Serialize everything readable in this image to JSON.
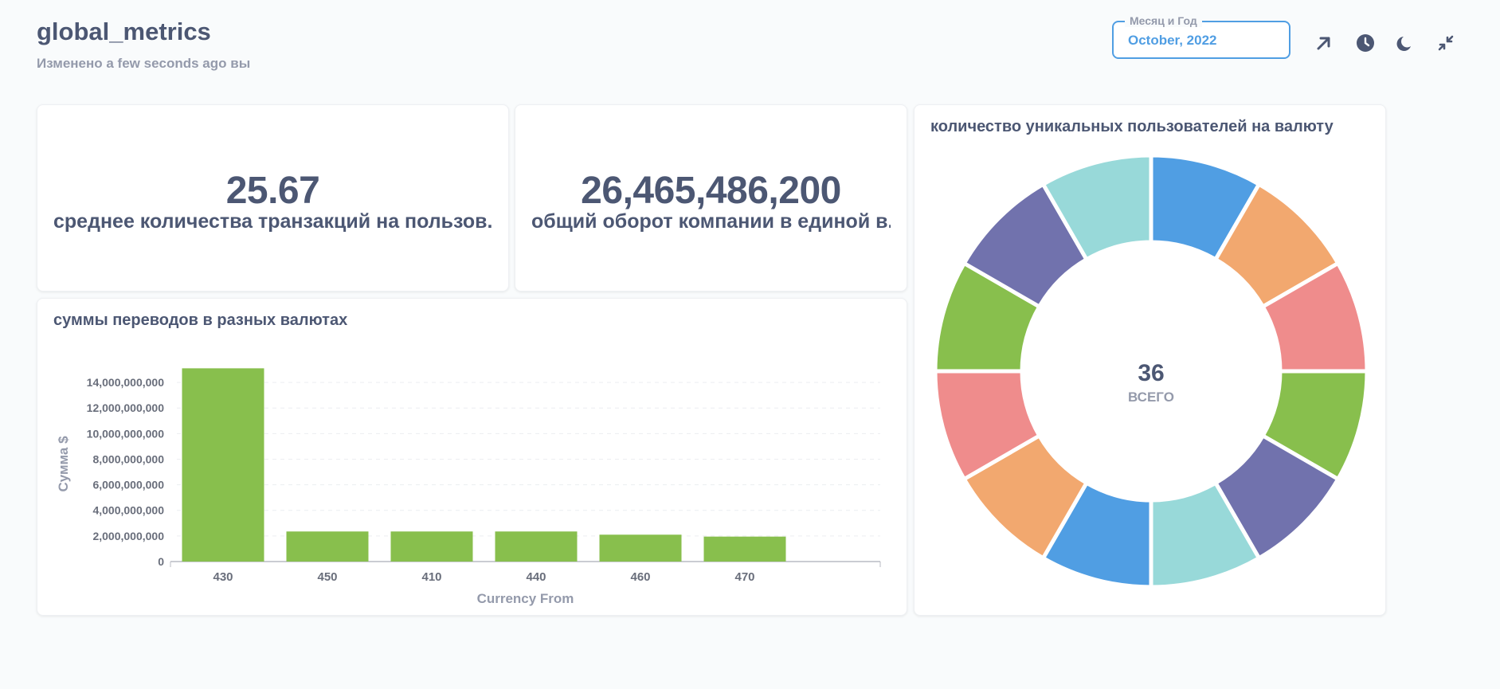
{
  "dashboard": {
    "title": "global_metrics",
    "subtitle": "Изменено a few seconds ago вы"
  },
  "filter": {
    "label": "Месяц и Год",
    "value": "October, 2022"
  },
  "header_icons": [
    "expand-arrow-icon",
    "clock-icon",
    "moon-icon",
    "collapse-icon"
  ],
  "cards": {
    "avg_tx": {
      "value": "25.67",
      "label": "среднее количества транзакций на пользов..."
    },
    "turnover": {
      "value": "26,465,486,200",
      "label": "общий оборот компании в единой в..."
    },
    "bar_chart": {
      "title": "суммы переводов в разных валютах"
    },
    "donut": {
      "title": "количество уникальных пользователей на валюту"
    }
  },
  "colors": {
    "accent": "#509ee3",
    "bar": "#88bf4d",
    "text": "#4c5773",
    "muted": "#949aab"
  },
  "chart_data": [
    {
      "type": "bar",
      "title": "суммы переводов в разных валютах",
      "xlabel": "Currency From",
      "ylabel": "Сумма $",
      "categories": [
        "430",
        "450",
        "410",
        "440",
        "460",
        "470"
      ],
      "values": [
        15100000000,
        2350000000,
        2350000000,
        2350000000,
        2100000000,
        1950000000
      ],
      "ylim": [
        0,
        15000000000
      ],
      "yticks": [
        "0",
        "2,000,000,000",
        "4,000,000,000",
        "6,000,000,000",
        "8,000,000,000",
        "10,000,000,000",
        "12,000,000,000",
        "14,000,000,000"
      ],
      "grid": true,
      "color": "#88bf4d"
    },
    {
      "type": "pie",
      "title": "количество уникальных пользователей на валюту",
      "donut": true,
      "total": "36",
      "total_label": "ВСЕГО",
      "values": [
        3,
        3,
        3,
        3,
        3,
        3,
        3,
        3,
        3,
        3,
        3,
        3
      ],
      "colors": [
        "#509ee3",
        "#f2a86f",
        "#ef8c8c",
        "#88bf4d",
        "#7172ad",
        "#98d9d9",
        "#509ee3",
        "#f2a86f",
        "#ef8c8c",
        "#88bf4d",
        "#7172ad",
        "#98d9d9"
      ]
    }
  ]
}
